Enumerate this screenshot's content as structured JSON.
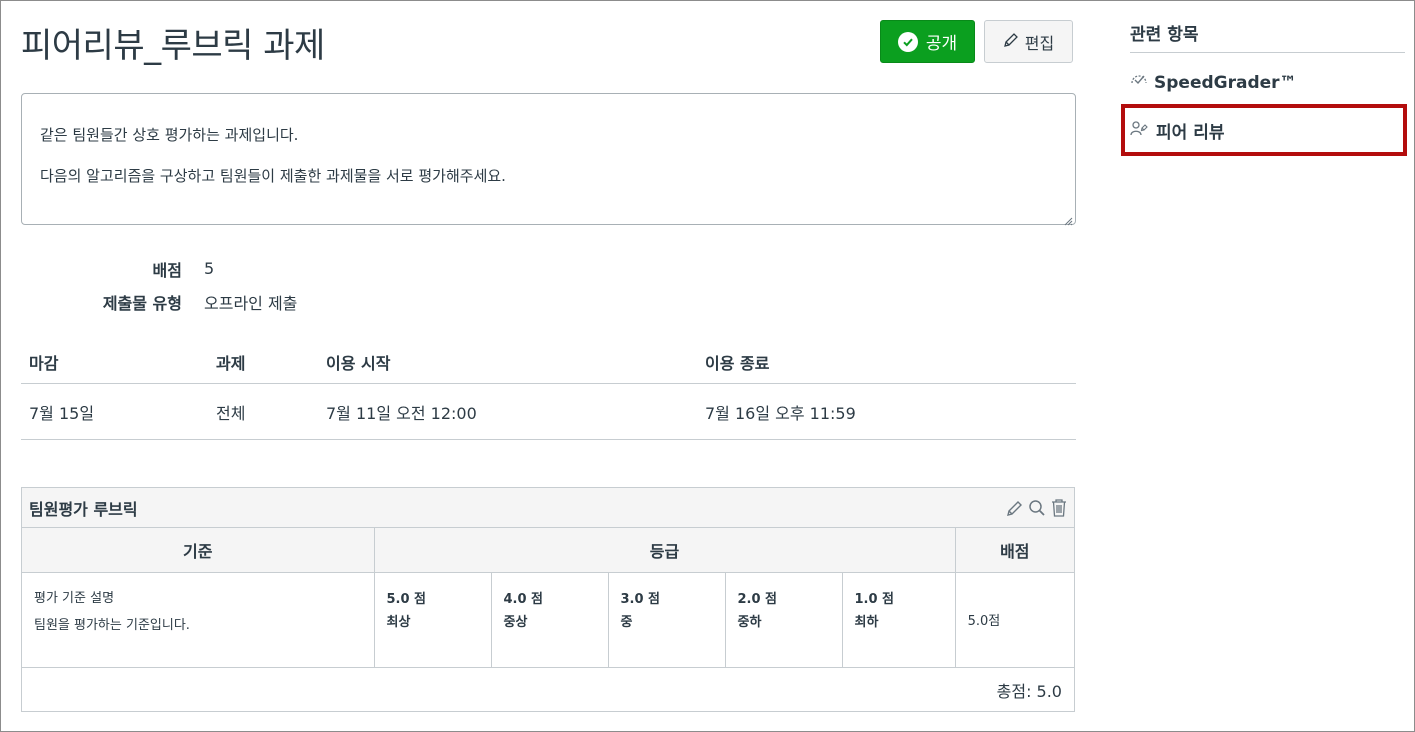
{
  "page": {
    "title": "피어리뷰_루브릭 과제",
    "publish_label": "공개",
    "edit_label": "편집"
  },
  "description": {
    "lines": [
      "같은 팀원들간 상호 평가하는 과제입니다.",
      "다음의 알고리즘을 구상하고 팀원들이 제출한 과제물을 서로 평가해주세요."
    ]
  },
  "details": {
    "points_label": "배점",
    "points_value": "5",
    "submission_label": "제출물 유형",
    "submission_value": "오프라인 제출"
  },
  "dates": {
    "headers": [
      "마감",
      "과제",
      "이용 시작",
      "이용 종료"
    ],
    "rows": [
      [
        "7월 15일",
        "전체",
        "7월 11일 오전 12:00",
        "7월 16일 오후 11:59"
      ]
    ]
  },
  "rubric": {
    "title": "팀원평가 루브릭",
    "col_criteria": "기준",
    "col_ratings": "등급",
    "col_points": "배점",
    "criterion_title": "평가 기준 설명",
    "criterion_desc": "팀원을 평가하는 기준입니다.",
    "ratings": [
      {
        "points": "5.0 점",
        "label": "최상"
      },
      {
        "points": "4.0 점",
        "label": "중상"
      },
      {
        "points": "3.0 점",
        "label": "중"
      },
      {
        "points": "2.0 점",
        "label": "중하"
      },
      {
        "points": "1.0 점",
        "label": "최하"
      }
    ],
    "criterion_points": "5.0점",
    "total": "총점: 5.0"
  },
  "sidebar": {
    "title": "관련 항목",
    "speedgrader": "SpeedGrader™",
    "peer_review": "피어 리뷰"
  },
  "colors": {
    "publish_green": "#0b9f1f",
    "highlight_red": "#b30d0d",
    "text": "#2d3b45"
  }
}
